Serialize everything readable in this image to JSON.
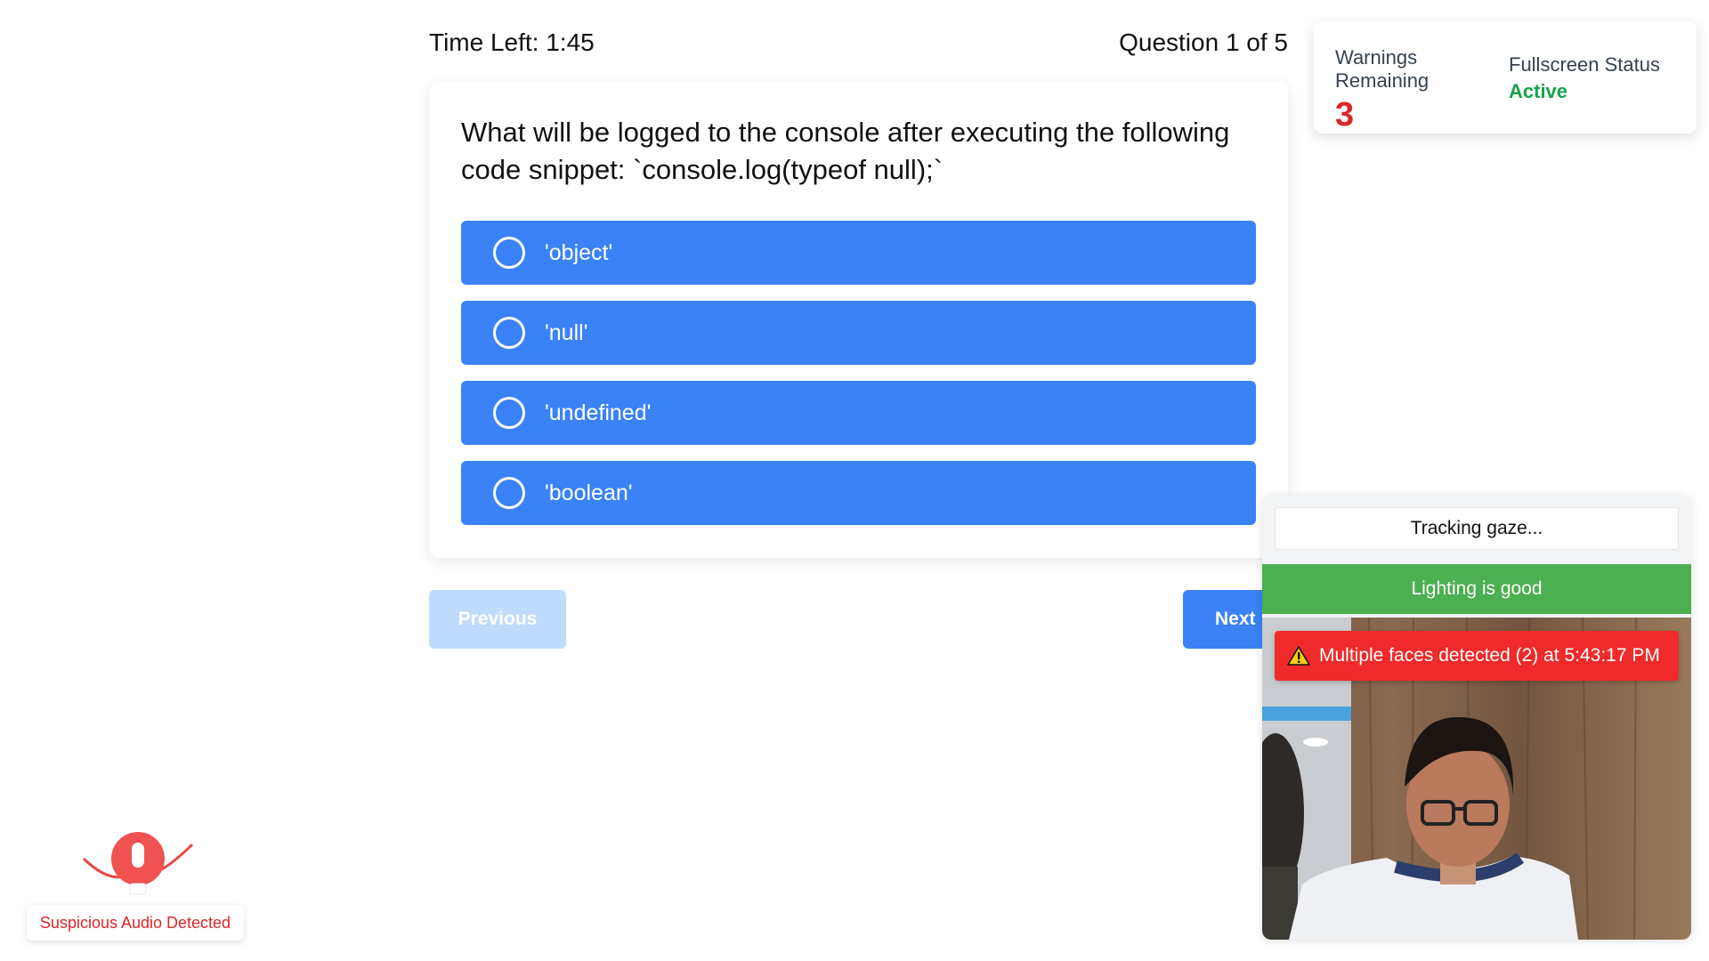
{
  "header": {
    "time_left": "Time Left: 1:45",
    "question_counter": "Question 1 of 5"
  },
  "status": {
    "warnings_label": "Warnings Remaining",
    "warnings_count": "3",
    "fullscreen_label": "Fullscreen Status",
    "fullscreen_value": "Active"
  },
  "quiz": {
    "question": "What will be logged to the console after executing the following code snippet: `console.log(typeof null);`",
    "options": [
      "'object'",
      "'null'",
      "'undefined'",
      "'boolean'"
    ]
  },
  "nav": {
    "previous_label": "Previous",
    "next_label": "Next"
  },
  "proctor": {
    "gaze_status": "Tracking gaze...",
    "lighting_status": "Lighting is good",
    "alert": "Multiple faces detected (2) at 5:43:17 PM"
  },
  "audio": {
    "label": "Suspicious Audio Detected"
  },
  "colors": {
    "option_bg": "#3b82f6",
    "warning_red": "#dc2626",
    "active_green": "#16a34a",
    "lighting_green": "#4caf50",
    "alert_red": "#ef2a2a",
    "prev_disabled": "#bfdbfe"
  },
  "icons": {
    "alert": "warning-triangle-icon",
    "audio": "microphone-icon",
    "option": "radio-circle-icon"
  }
}
